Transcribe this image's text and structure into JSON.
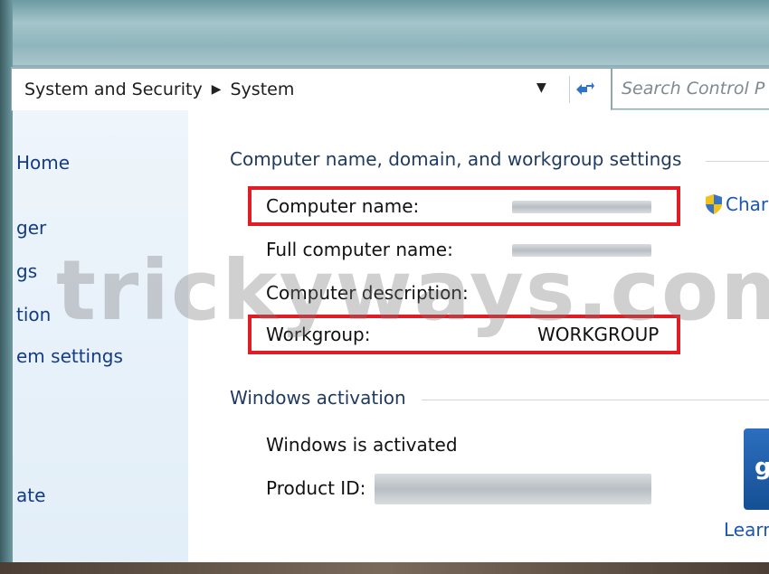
{
  "address_bar": {
    "breadcrumbs": [
      "System and Security",
      "System"
    ],
    "separator": "▶",
    "search_placeholder": "Search Control P"
  },
  "left_nav": {
    "items": [
      "Home",
      "ger",
      "gs",
      "tion",
      "em settings",
      "ate"
    ]
  },
  "computer_section": {
    "title": "Computer name, domain, and workgroup settings",
    "rows": [
      {
        "label": "Computer name:",
        "value": ""
      },
      {
        "label": "Full computer name:",
        "value": ""
      },
      {
        "label": "Computer description:",
        "value": ""
      },
      {
        "label": "Workgroup:",
        "value": "WORKGROUP"
      }
    ],
    "change_link": "Char"
  },
  "activation_section": {
    "title": "Windows activation",
    "status": "Windows is activated",
    "product_id_label": "Product ID:",
    "genuine_text": "g",
    "learn_link": "Learn"
  },
  "watermark": "trickyways.com",
  "colors": {
    "highlight": "#e01c24",
    "link": "#1a56b5",
    "nav_link": "#143c85"
  }
}
